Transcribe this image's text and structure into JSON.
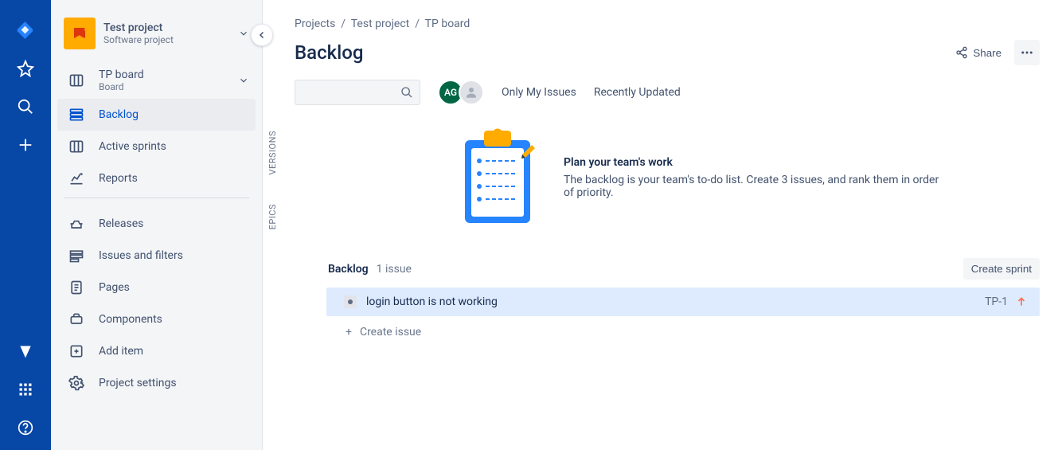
{
  "project": {
    "name": "Test project",
    "subtitle": "Software project"
  },
  "sidebar": {
    "board": {
      "label": "TP board",
      "sub": "Board"
    },
    "items": [
      {
        "label": "Backlog"
      },
      {
        "label": "Active sprints"
      },
      {
        "label": "Reports"
      }
    ],
    "secondary": [
      {
        "label": "Releases"
      },
      {
        "label": "Issues and filters"
      },
      {
        "label": "Pages"
      },
      {
        "label": "Components"
      },
      {
        "label": "Add item"
      },
      {
        "label": "Project settings"
      }
    ]
  },
  "breadcrumbs": {
    "a": "Projects",
    "b": "Test project",
    "c": "TP board"
  },
  "page": {
    "title": "Backlog",
    "share": "Share"
  },
  "filters": {
    "only_my": "Only My Issues",
    "recent": "Recently Updated"
  },
  "avatars": {
    "ag": "AG"
  },
  "side_tabs": {
    "versions": "VERSIONS",
    "epics": "EPICS"
  },
  "hero": {
    "title": "Plan your team's work",
    "body": "The backlog is your team's to-do list. Create 3 issues, and rank them in order of priority."
  },
  "section": {
    "title": "Backlog",
    "count": "1 issue",
    "create_sprint": "Create sprint"
  },
  "issue": {
    "summary": "login button is not working",
    "key": "TP-1"
  },
  "create_issue": "Create issue"
}
